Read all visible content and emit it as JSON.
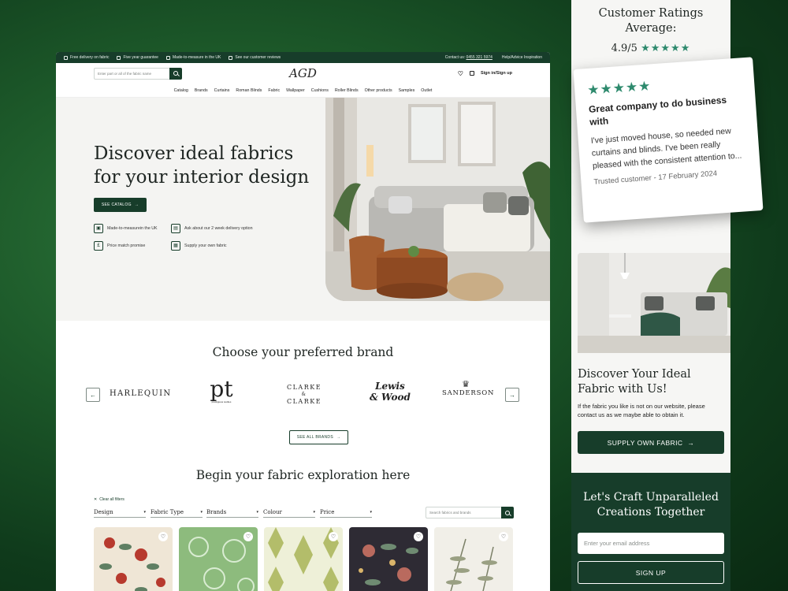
{
  "topbar": {
    "items": [
      "Free delivery on fabric",
      "Five year guarantee",
      "Made-to-measure in the UK",
      "See our customer reviews"
    ],
    "contact_label": "Contact us:",
    "phone": "0455 321 5974",
    "help": "Help/Advice Inspiration"
  },
  "header": {
    "search_placeholder": "Enter part or all of the fabric name",
    "logo": "AGD",
    "signin": "Sign in/Sign up"
  },
  "nav": [
    "Catalog",
    "Brands",
    "Curtains",
    "Roman Blinds",
    "Fabric",
    "Wallpaper",
    "Cushions",
    "Roller Blinds",
    "Other products",
    "Samples",
    "Outlet"
  ],
  "hero": {
    "title_line1": "Discover ideal fabrics",
    "title_line2": "for your interior design",
    "cta": "SEE CATALOG",
    "features": [
      "Made-to-measurein the UK",
      "Ask about our 2 week delivery option",
      "Price match promise",
      "Supply your own fabric"
    ]
  },
  "brands": {
    "title": "Choose your preferred brand",
    "logos": [
      "HARLEQUIN",
      "pt",
      "CLARKE",
      "&",
      "CLARKE",
      "Lewis",
      "& Wood",
      "SANDERSON"
    ],
    "pt_sub": "prestigious textiles",
    "see_all": "SEE ALL BRANDS"
  },
  "explore": {
    "title": "Begin your fabric exploration here",
    "clear": "Clear all filters",
    "filters": [
      "Design",
      "Fabric Type",
      "Brands",
      "Colour",
      "Price"
    ],
    "search_placeholder": "Search fabrics and brands"
  },
  "panel": {
    "ratings_line1": "Customer Ratings",
    "ratings_line2": "Average:",
    "score": "4.9/5",
    "stars": "★★★★★",
    "review_title": "Great company to do business with",
    "review_body": "I've just moved house, so needed new curtains and blinds. I've been really pleased with the consistent attention to...",
    "review_meta": "Trusted customer - 17 February 2024",
    "discover_title": "Discover Your Ideal Fabric with Us!",
    "discover_text": "If the fabric you like is not on our website, please contact us as we maybe able to obtain it.",
    "supply_btn": "SUPPLY OWN FABRIC",
    "craft_line1": "Let's Craft Unparalleled",
    "craft_line2": "Creations Together",
    "email_placeholder": "Enter your email address",
    "signup_btn": "SIGN UP"
  },
  "colors": {
    "brand_green": "#173d2a",
    "star_green": "#2e8a6d"
  }
}
